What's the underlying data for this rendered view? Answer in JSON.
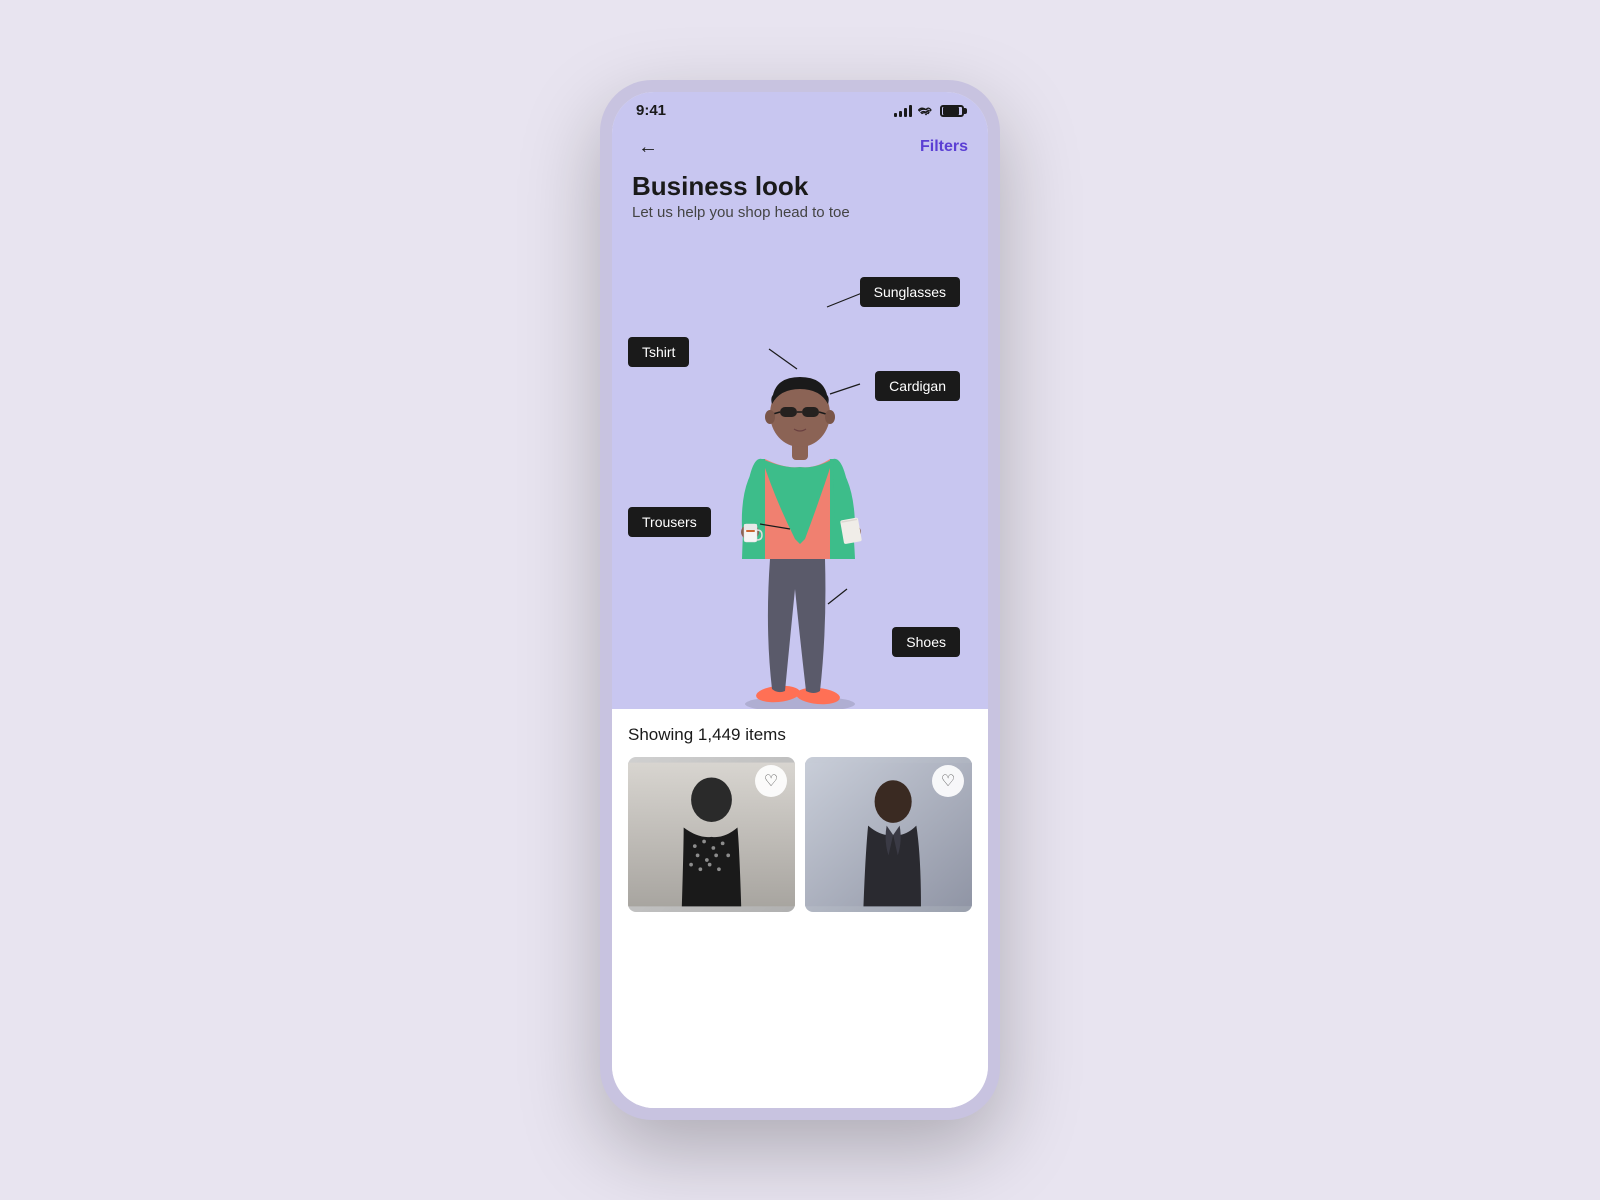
{
  "statusBar": {
    "time": "9:41",
    "signalBars": [
      3,
      6,
      9,
      12
    ],
    "batteryPercent": 80
  },
  "nav": {
    "backLabel": "←",
    "filtersLabel": "Filters"
  },
  "hero": {
    "title": "Business look",
    "subtitle": "Let us help you shop head to toe",
    "bgColor": "#c8c6f0"
  },
  "labels": {
    "sunglasses": "Sunglasses",
    "tshirt": "Tshirt",
    "cardigan": "Cardigan",
    "trousers": "Trousers",
    "shoes": "Shoes"
  },
  "itemCount": "Showing 1,449 items",
  "products": [
    {
      "id": 1,
      "bgColor1": "#d0cece",
      "bgColor2": "#b5b5b5",
      "wishlisted": false
    },
    {
      "id": 2,
      "bgColor1": "#c0c5d0",
      "bgColor2": "#8e98a8",
      "wishlisted": false
    }
  ],
  "icons": {
    "back": "←",
    "heart": "♡",
    "signal": "▌",
    "wifi": "⌿",
    "battery": "▮"
  }
}
